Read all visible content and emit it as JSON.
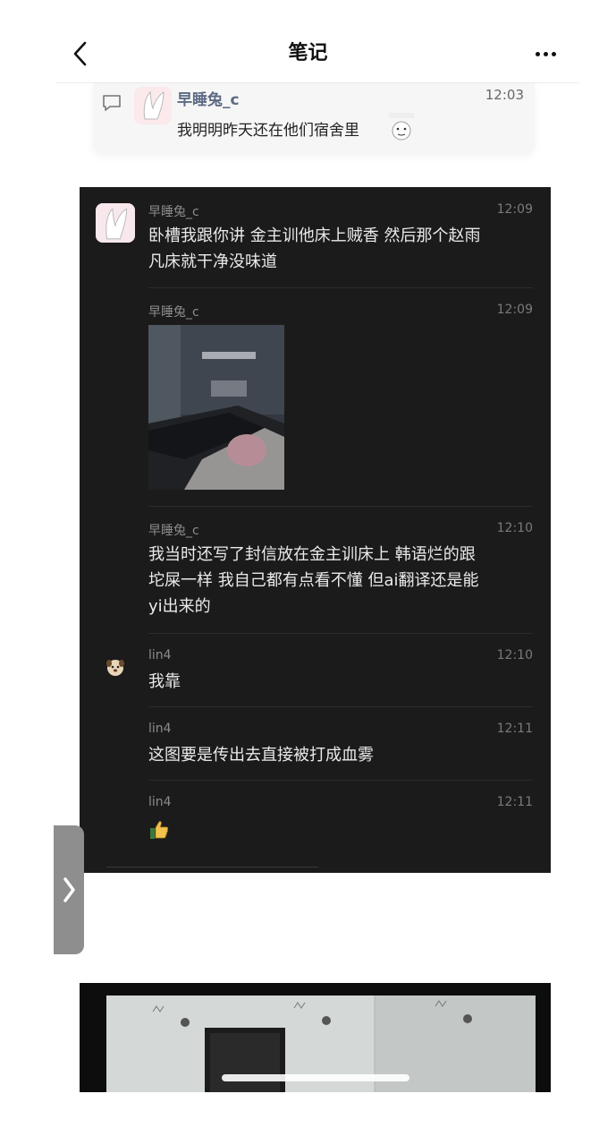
{
  "navbar": {
    "title": "笔记",
    "back_icon": "chevron-left-icon",
    "more_icon": "more-horizontal-icon"
  },
  "light_card": {
    "name": "早睡兔_c",
    "time": "12:03",
    "text": "我明明昨天还在他们宿舍里",
    "comment_icon": "comment-icon",
    "emoji_icon": "sticker-emoji-icon"
  },
  "chat": {
    "messages": [
      {
        "name": "早睡兔_c",
        "time": "12:09",
        "text_line1": "卧槽我跟你讲 金主训他床上贼香 然后那个赵雨",
        "text_line2": "凡床就干净没味道"
      },
      {
        "name": "早睡兔_c",
        "time": "12:09",
        "image": "bedroom-photo"
      },
      {
        "name": "早睡兔_c",
        "time": "12:10",
        "text_line1": "我当时还写了封信放在金主训床上 韩语烂的跟",
        "text_line2": "坨屎一样 我自己都有点看不懂 但ai翻译还是能",
        "text_line3": "yi出来的"
      },
      {
        "name": "lin4",
        "time": "12:10",
        "text": "我靠"
      },
      {
        "name": "lin4",
        "time": "12:11",
        "text": "这图要是传出去直接被打成血雾"
      },
      {
        "name": "lin4",
        "time": "12:11",
        "emoji": "thumbs-up-icon"
      }
    ]
  },
  "side_handle_icon": "chevron-right-icon",
  "colors": {
    "dark_bg": "#1b1b1b",
    "name_blue": "#5d6a84",
    "light_card_bg": "#f6f6f6"
  }
}
